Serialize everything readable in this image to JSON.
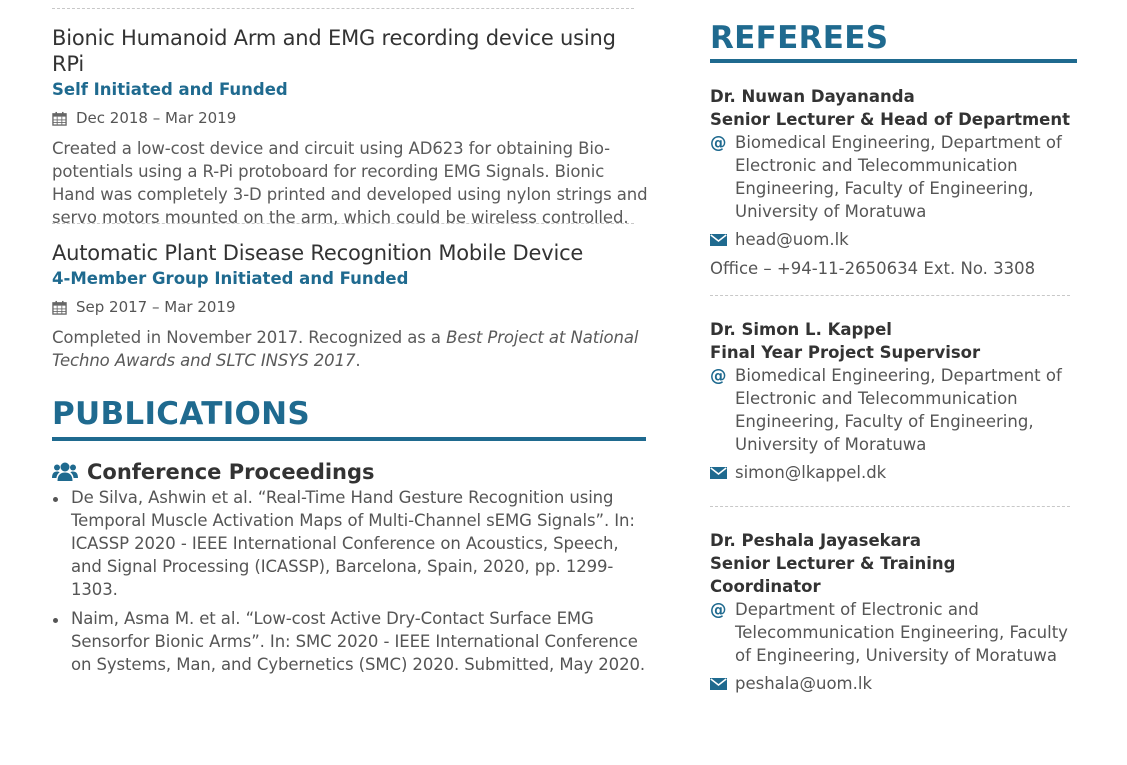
{
  "projects": [
    {
      "title": "Bionic Humanoid Arm and EMG recording device using RPi",
      "subtitle": "Self Initiated and Funded",
      "date": "Dec 2018 – Mar 2019",
      "description": "Created a low-cost device and circuit using AD623 for obtaining Bio-potentials using a R-Pi protoboard for recording EMG Signals. Bionic Hand was completely 3-D printed and developed using nylon strings and servo motors mounted on the arm, which could be wireless controlled."
    },
    {
      "title": "Automatic Plant Disease Recognition Mobile Device",
      "subtitle": "4-Member Group Initiated and Funded",
      "date": "Sep 2017 – Mar 2019",
      "description_prefix": "Completed in November 2017. Recognized as a ",
      "description_emphasis": "Best Project at National Techno Awards and SLTC INSYS 2017",
      "description_suffix": "."
    }
  ],
  "publications": {
    "title": "PUBLICATIONS",
    "subheading": "Conference Proceedings",
    "items": [
      "De Silva, Ashwin et al. “Real-Time Hand Gesture Recognition using Temporal Muscle Activation Maps of Multi-Channel sEMG Signals”. In: ICASSP 2020 - IEEE International Conference on Acoustics, Speech, and Signal Processing (ICASSP), Barcelona, Spain, 2020, pp. 1299-1303.",
      "Naim, Asma M. et al. “Low-cost Active Dry-Contact Surface EMG Sensorfor Bionic Arms”. In: SMC 2020 - IEEE International Conference on Systems, Man, and Cybernetics (SMC) 2020. Submitted, May 2020."
    ]
  },
  "referees": {
    "title": "REFEREES",
    "people": [
      {
        "name": "Dr. Nuwan Dayananda",
        "role": "Senior Lecturer & Head of Department",
        "affiliation": "Biomedical Engineering, Department of Electronic and Telecommunication Engineering, Faculty of Engineering, University of Moratuwa",
        "email": "head@uom.lk",
        "office": "Office – +94-11-2650634 Ext. No. 3308"
      },
      {
        "name": "Dr. Simon L. Kappel",
        "role": "Final Year Project Supervisor",
        "affiliation": "Biomedical Engineering, Department of Electronic and Telecommunication Engineering, Faculty of Engineering, University of Moratuwa",
        "email": "simon@lkappel.dk"
      },
      {
        "name": "Dr. Peshala Jayasekara",
        "role": "Senior Lecturer & Training Coordinator",
        "affiliation": "Department of Electronic and Telecommunication Engineering, Faculty of Engineering, University of Moratuwa",
        "email": "peshala@uom.lk"
      }
    ]
  },
  "icons": {
    "date": "calendar-icon",
    "group": "users-icon",
    "affiliation": "at-sign-icon",
    "email": "envelope-icon"
  },
  "colors": {
    "accent": "#1f6a8f",
    "text": "#555555",
    "heading": "#333333"
  },
  "at_symbol": "@"
}
